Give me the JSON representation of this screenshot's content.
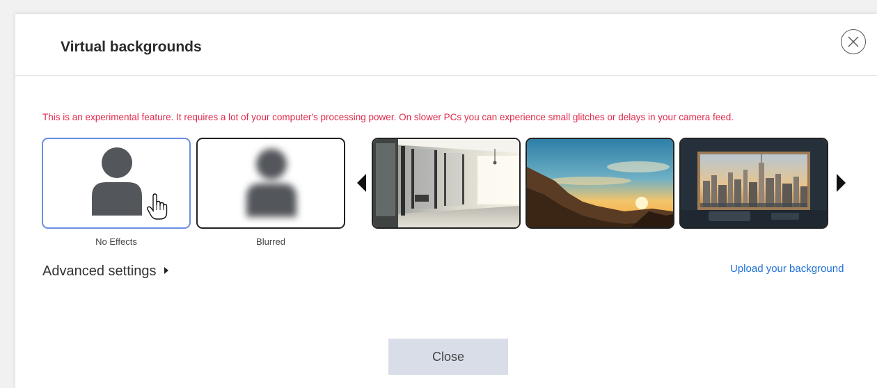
{
  "dialog": {
    "title": "Virtual backgrounds",
    "close_icon": "close-circle-icon",
    "warning": "This is an experimental feature. It requires a lot of your computer's processing power. On slower PCs you can experience small glitches or delays in your camera feed.",
    "warning_color": "#e0284a"
  },
  "effects": [
    {
      "label": "No Effects",
      "icon": "person-icon",
      "selected": true
    },
    {
      "label": "Blurred",
      "icon": "blurred-person-icon",
      "selected": false
    }
  ],
  "backgrounds": [
    {
      "name": "office-glass-background"
    },
    {
      "name": "mountain-sunset-background"
    },
    {
      "name": "city-window-background"
    }
  ],
  "navigation": {
    "prev_icon": "arrow-left-icon",
    "next_icon": "arrow-right-icon"
  },
  "advanced_settings": {
    "label": "Advanced settings"
  },
  "upload": {
    "label": "Upload your background",
    "color": "#1d6fd8"
  },
  "footer": {
    "close_label": "Close"
  },
  "colors": {
    "selected_border": "#6a8ee0",
    "close_button_bg": "#d9dde7"
  }
}
